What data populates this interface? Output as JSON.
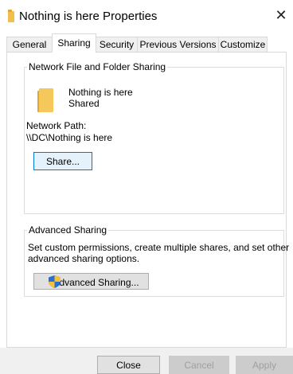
{
  "window": {
    "title": "Nothing is here Properties"
  },
  "tabs": [
    {
      "label": "General"
    },
    {
      "label": "Sharing"
    },
    {
      "label": "Security"
    },
    {
      "label": "Previous Versions"
    },
    {
      "label": "Customize"
    }
  ],
  "network_sharing": {
    "group_label": "Network File and Folder Sharing",
    "folder_name": "Nothing is here",
    "status": "Shared",
    "path_label": "Network Path:",
    "path_value": "\\\\DC\\Nothing is here",
    "share_button": "Share..."
  },
  "advanced_sharing": {
    "group_label": "Advanced Sharing",
    "description_line1": "Set custom permissions, create multiple shares, and set other",
    "description_line2": "advanced sharing options.",
    "button_label": "Advanced Sharing..."
  },
  "footer": {
    "close": "Close",
    "cancel": "Cancel",
    "apply": "Apply"
  },
  "colors": {
    "folder": "#f2c04a",
    "accent": "#0078d7"
  }
}
